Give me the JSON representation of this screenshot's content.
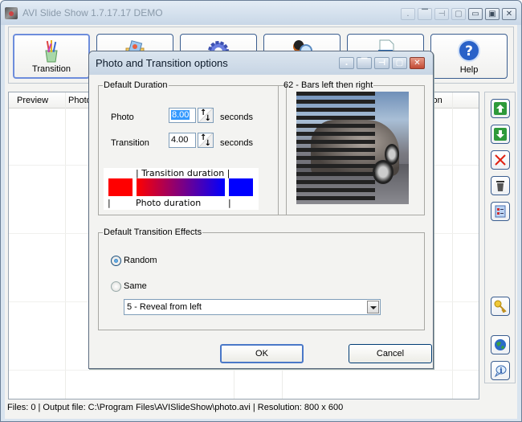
{
  "window": {
    "title": "AVI Slide Show 1.7.17.17 DEMO",
    "caption_buttons": [
      "dock-bottom",
      "dock-top",
      "dock-right",
      "dock-fill",
      "minimize",
      "maximize",
      "close"
    ]
  },
  "toolbar": {
    "buttons": [
      {
        "label": "Transition",
        "icon": "paintbrushes-icon",
        "active": true
      },
      {
        "label": "",
        "icon": "photo-folder-icon"
      },
      {
        "label": "",
        "icon": "gear-icon"
      },
      {
        "label": "",
        "icon": "user-search-icon"
      },
      {
        "label": "",
        "icon": "video-file-icon"
      },
      {
        "label": "Help",
        "icon": "help-icon"
      }
    ]
  },
  "list": {
    "columns": [
      "Preview",
      "Photo",
      "Transition"
    ],
    "visible_column_fragments": {
      "right": "tion"
    }
  },
  "side_buttons": [
    {
      "name": "move-up",
      "icon": "arrow-up-icon"
    },
    {
      "name": "move-down",
      "icon": "arrow-down-icon"
    },
    {
      "name": "remove",
      "icon": "red-x-icon"
    },
    {
      "name": "delete-all",
      "icon": "trash-icon"
    },
    {
      "name": "properties",
      "icon": "checklist-icon"
    },
    {
      "name": "register",
      "icon": "key-icon"
    },
    {
      "name": "website",
      "icon": "globe-icon"
    },
    {
      "name": "about",
      "icon": "info-icon"
    }
  ],
  "status_bar": {
    "text": "Files: 0 | Output file: C:\\Program Files\\AVISlideShow\\photo.avi | Resolution: 800 x 600"
  },
  "dialog": {
    "title": "Photo and Transition options",
    "duration_group": {
      "legend": "Default Duration",
      "photo_label": "Photo",
      "photo_value": "8.00",
      "transition_label": "Transition",
      "transition_value": "4.00",
      "unit": "seconds",
      "timeline_top_label": "| Transition duration |",
      "timeline_bottom_label": "Photo duration",
      "colors": {
        "photo_start": "#ff0000",
        "photo_end": "#0000ff"
      }
    },
    "preview_group": {
      "legend": "62 - Bars left then right"
    },
    "effects_group": {
      "legend": "Default Transition Effects",
      "options": [
        {
          "label": "Random",
          "checked": true
        },
        {
          "label": "Same",
          "checked": false
        }
      ],
      "selected_effect": "5 - Reveal from left"
    },
    "ok_label": "OK",
    "cancel_label": "Cancel"
  }
}
